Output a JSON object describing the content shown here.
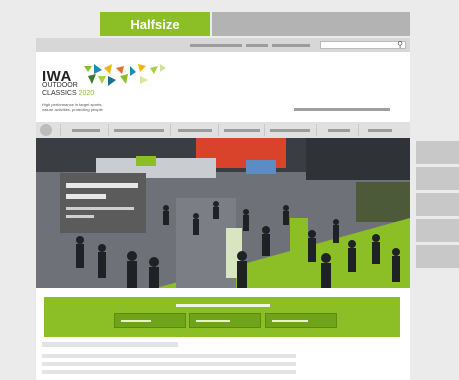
{
  "tabs": {
    "active_label": "Halfsize"
  },
  "logo": {
    "brand": "IWA",
    "line1": "OUTDOOR",
    "line2": "CLASSICS",
    "year": "2020",
    "tagline": "High performance in target sports, nature activities, protecting people"
  },
  "icons": {
    "search": "search-icon",
    "home": "home-icon"
  },
  "colors": {
    "accent": "#8cbf26",
    "tab_inactive": "#b3b3b3",
    "background": "#ebebeb"
  }
}
